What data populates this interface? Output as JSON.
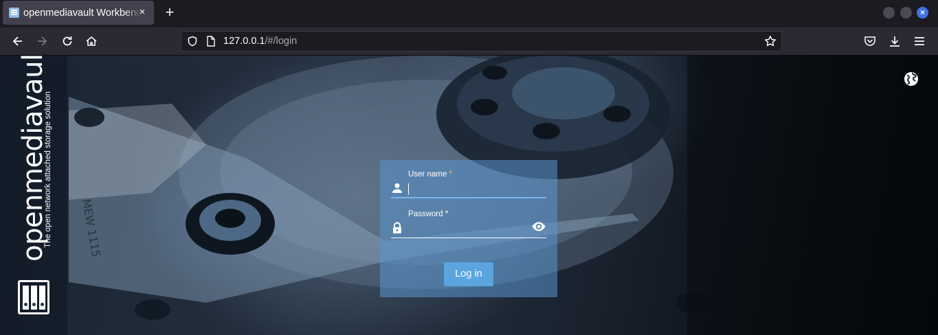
{
  "browser": {
    "tab_title": "openmediavault Workbench",
    "tab_close": "×",
    "new_tab": "+",
    "url_host": "127.0.0.1",
    "url_path": "/#/login",
    "icons": [
      "back-icon",
      "forward-icon",
      "reload-icon",
      "home-icon",
      "shield-icon",
      "page-icon",
      "bookmark-star-icon",
      "pocket-icon",
      "download-icon",
      "menu-icon"
    ],
    "close_glyph": "×",
    "accent": "#3f72e4"
  },
  "sidebar": {
    "brand_name": "openmediavault",
    "tagline": "The open network attached storage solution"
  },
  "login": {
    "username_label": "User name",
    "username_required": "*",
    "username_value": "",
    "password_label": "Password",
    "password_required": "*",
    "password_value": "",
    "submit_label": "Log in",
    "accent": "#5aa4e0"
  }
}
